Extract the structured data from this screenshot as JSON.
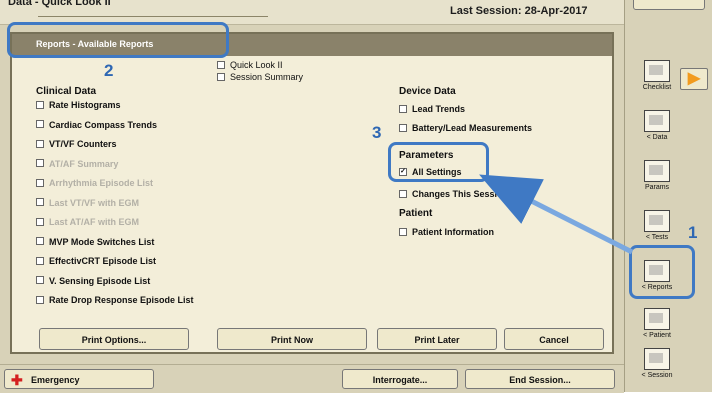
{
  "header": {
    "title": "Data - Quick Look II",
    "session": "Last Session: 28-Apr-2017"
  },
  "dialog": {
    "title": "Reports - Available Reports",
    "top_options": [
      "Quick Look II",
      "Session Summary"
    ],
    "clinical": {
      "heading": "Clinical Data",
      "items": [
        {
          "label": "Rate Histograms",
          "checked": false,
          "enabled": true
        },
        {
          "label": "Cardiac Compass Trends",
          "checked": false,
          "enabled": true
        },
        {
          "label": "VT/VF Counters",
          "checked": false,
          "enabled": true
        },
        {
          "label": "AT/AF Summary",
          "checked": false,
          "enabled": false
        },
        {
          "label": "Arrhythmia Episode List",
          "checked": false,
          "enabled": false
        },
        {
          "label": "Last VT/VF with EGM",
          "checked": false,
          "enabled": false
        },
        {
          "label": "Last AT/AF with EGM",
          "checked": false,
          "enabled": false
        },
        {
          "label": "MVP Mode Switches List",
          "checked": false,
          "enabled": true
        },
        {
          "label": "EffectivCRT Episode List",
          "checked": false,
          "enabled": true
        },
        {
          "label": "V. Sensing Episode List",
          "checked": false,
          "enabled": true
        },
        {
          "label": "Rate Drop Response Episode List",
          "checked": false,
          "enabled": true
        }
      ]
    },
    "device": {
      "heading": "Device Data",
      "items": [
        {
          "label": "Lead Trends",
          "checked": false
        },
        {
          "label": "Battery/Lead Measurements",
          "checked": false
        }
      ]
    },
    "parameters": {
      "heading": "Parameters",
      "items": [
        {
          "label": "All Settings",
          "checked": true
        },
        {
          "label": "Changes This Session",
          "checked": false
        }
      ]
    },
    "patient": {
      "heading": "Patient",
      "items": [
        {
          "label": "Patient Information",
          "checked": false
        }
      ]
    },
    "buttons": {
      "print_options": "Print Options...",
      "print_now": "Print Now",
      "print_later": "Print Later",
      "cancel": "Cancel"
    }
  },
  "bottom_bar": {
    "emergency": "Emergency",
    "interrogate": "Interrogate...",
    "end_session": "End Session..."
  },
  "sidebar": {
    "items": [
      "Checklist",
      "< Data",
      "Params",
      "< Tests",
      "< Reports",
      "< Patient",
      "< Session"
    ]
  },
  "annotations": {
    "one": "1",
    "two": "2",
    "three": "3"
  },
  "colors": {
    "annotation": "#3f79c4",
    "dialog_titlebar": "#8a826a",
    "dialog_bg": "#f3eed9",
    "background": "#d8d2b8"
  }
}
